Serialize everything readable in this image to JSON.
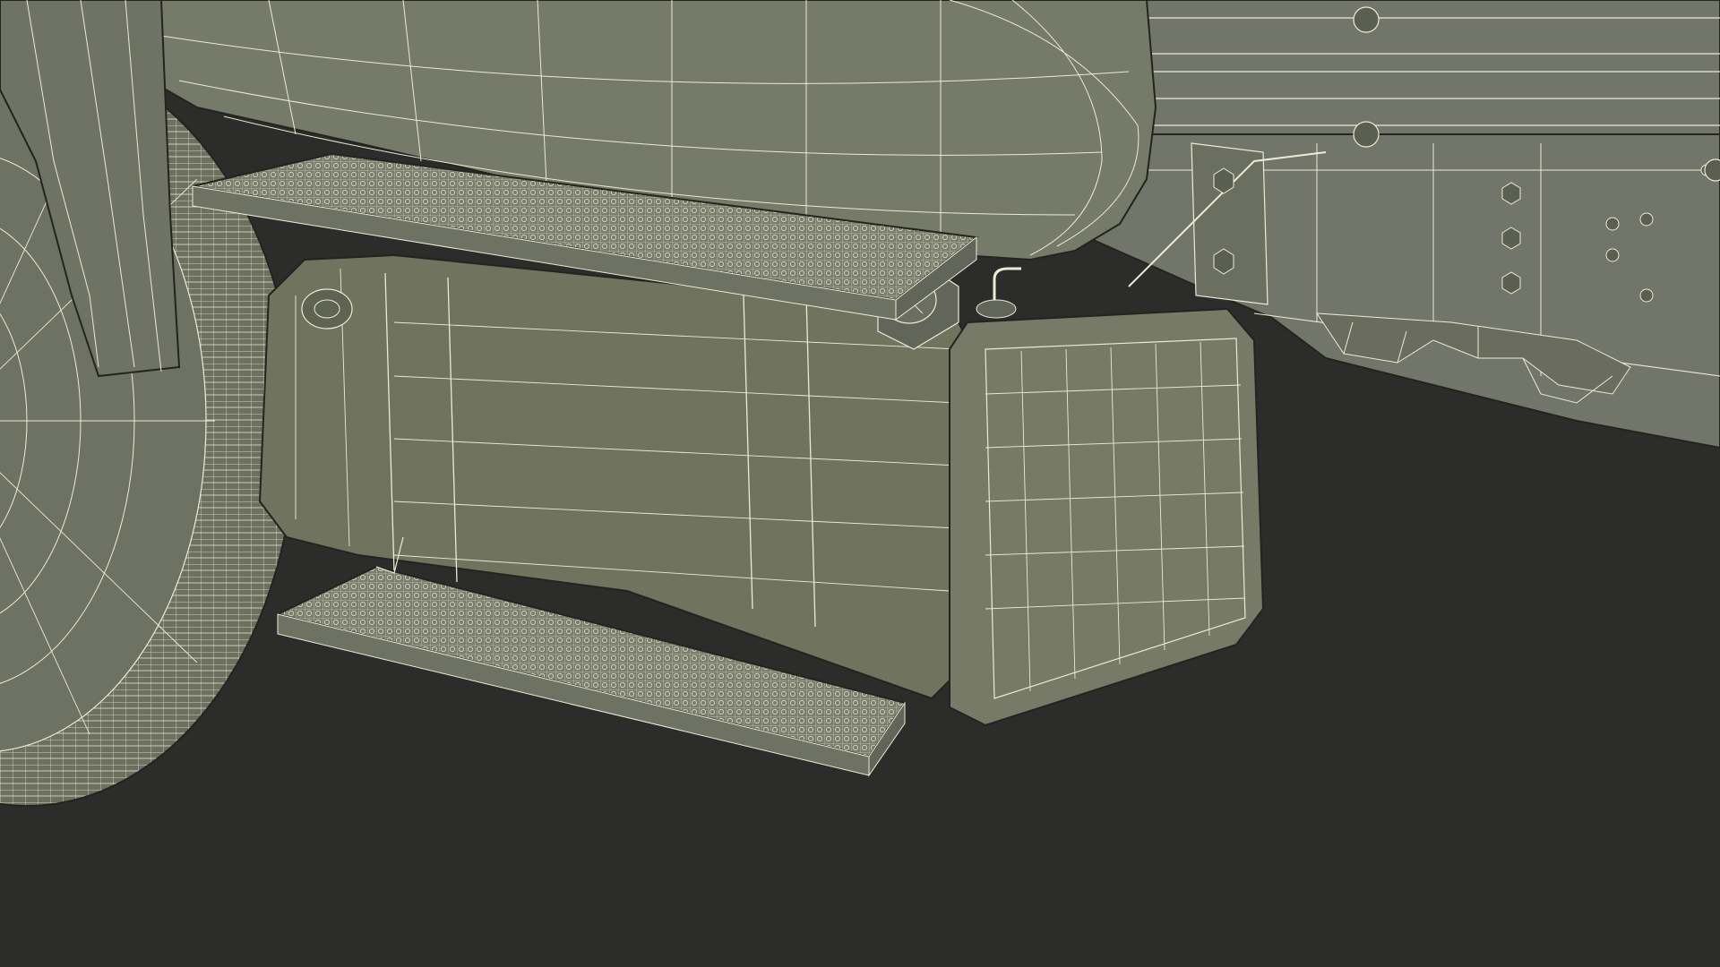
{
  "scene": {
    "colors": {
      "background": "#2c2c2a",
      "surface": "#737765",
      "surface_dark": "#5b5f50",
      "surface_light": "#878b78",
      "wire": "#ecebd5",
      "outline": "#23241f"
    },
    "subject": "wireframe-truck-fuel-tank-with-steps"
  }
}
